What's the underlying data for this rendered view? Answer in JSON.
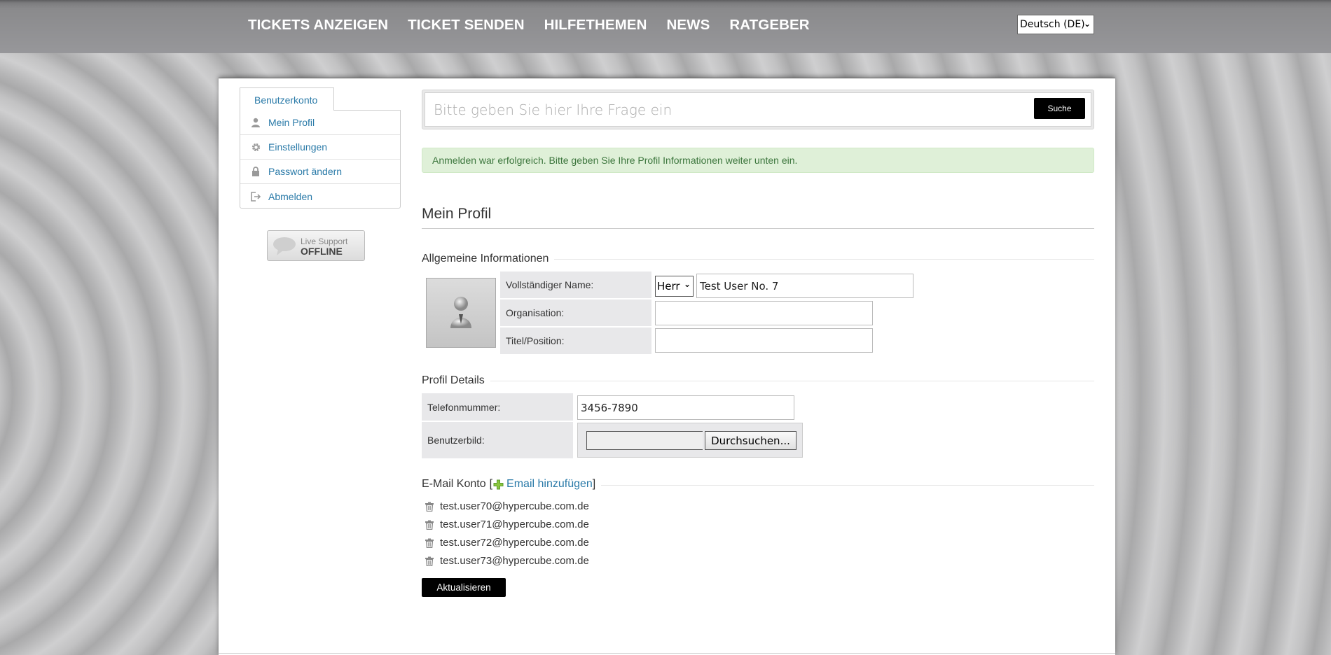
{
  "nav": {
    "items": [
      {
        "label": "TICKETS ANZEIGEN"
      },
      {
        "label": "TICKET SENDEN"
      },
      {
        "label": "HILFETHEMEN"
      },
      {
        "label": "NEWS"
      },
      {
        "label": "RATGEBER"
      }
    ],
    "language": "Deutsch (DE)"
  },
  "sidebar": {
    "tab_label": "Benutzerkonto",
    "items": [
      {
        "label": "Mein Profil",
        "icon": "user-icon"
      },
      {
        "label": "Einstellungen",
        "icon": "gear-icon"
      },
      {
        "label": "Passwort ändern",
        "icon": "lock-icon"
      },
      {
        "label": "Abmelden",
        "icon": "logout-icon"
      }
    ],
    "live_support": {
      "line1": "Live Support",
      "line2": "OFFLINE"
    }
  },
  "search": {
    "placeholder": "Bitte geben Sie hier Ihre Frage ein",
    "button_label": "Suche"
  },
  "alert": {
    "message": "Anmelden war erfolgreich. Bitte geben Sie Ihre Profil Informationen weiter unten ein."
  },
  "profile": {
    "title": "Mein Profil",
    "general": {
      "legend": "Allgemeine Informationen",
      "full_name_label": "Vollständiger Name:",
      "salutation": "Herr",
      "full_name_value": "Test User No. 7",
      "organisation_label": "Organisation:",
      "organisation_value": "",
      "title_label": "Titel/Position:",
      "title_value": ""
    },
    "details": {
      "legend": "Profil Details",
      "phone_label": "Telefonmummer:",
      "phone_value": "3456-7890",
      "avatar_label": "Benutzerbild:",
      "browse_label": "Durchsuchen..."
    },
    "email": {
      "legend": "E-Mail Konto",
      "bracket_open": "[",
      "add_label": "Email hinzufügen",
      "bracket_close": "]",
      "addresses": [
        "test.user70@hypercube.com.de",
        "test.user71@hypercube.com.de",
        "test.user72@hypercube.com.de",
        "test.user73@hypercube.com.de"
      ]
    },
    "update_label": "Aktualisieren"
  },
  "colors": {
    "link": "#2a7aa8",
    "success_bg": "#dff0d8",
    "success_text": "#3c763d",
    "button_bg": "#000000"
  }
}
